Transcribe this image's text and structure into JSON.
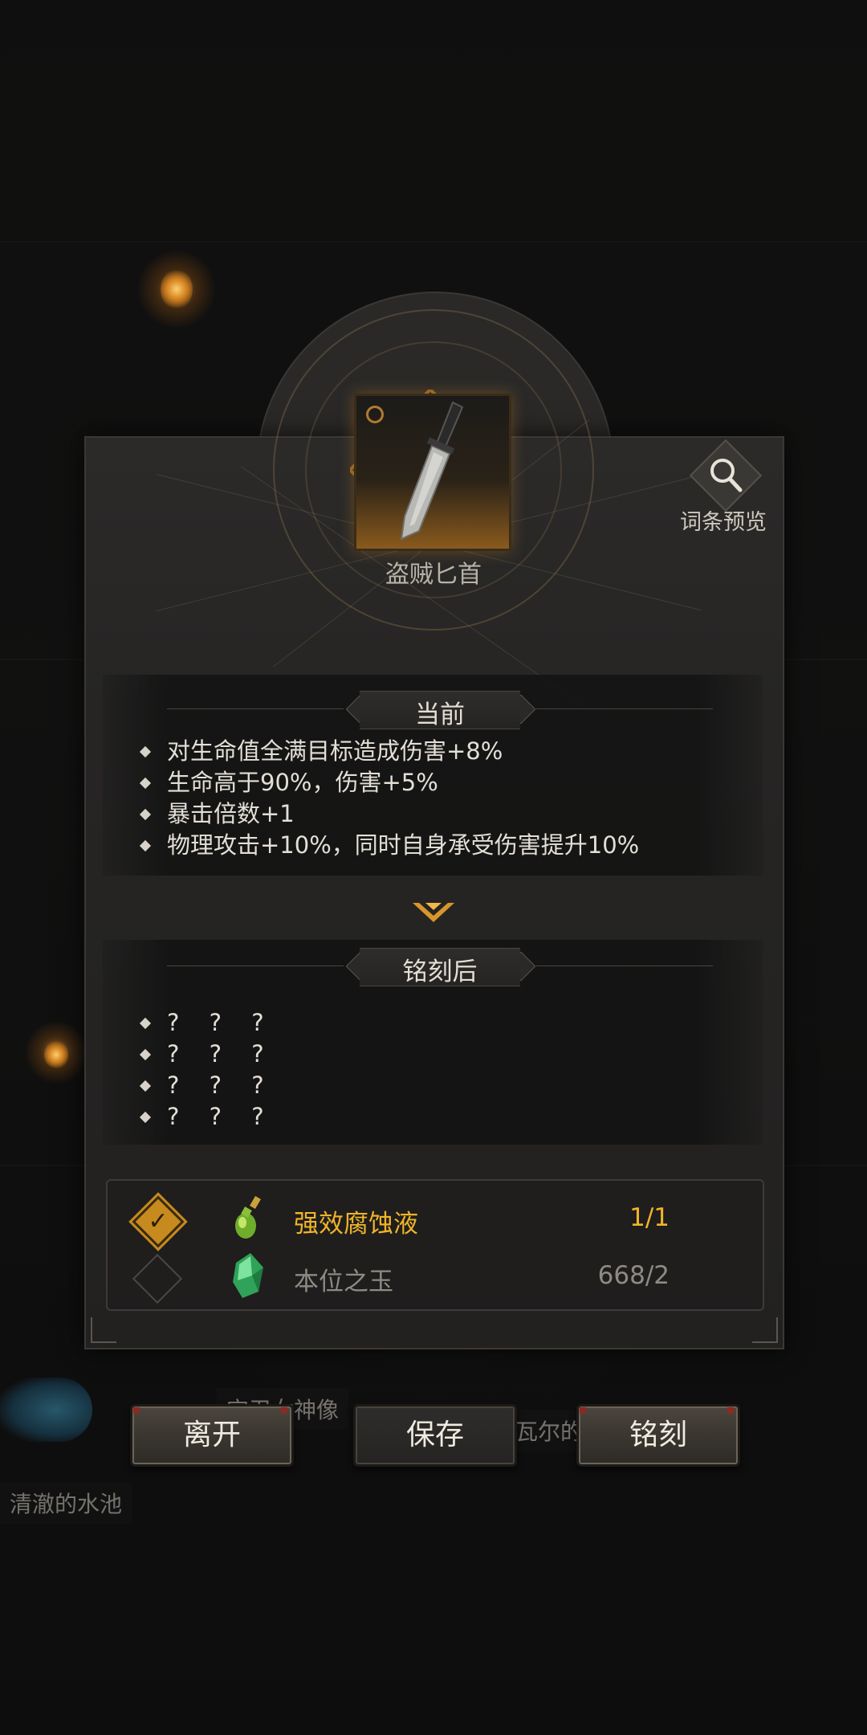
{
  "item": {
    "name": "盗贼匕首",
    "preview_label": "词条预览"
  },
  "current": {
    "title": "当前",
    "affixes": [
      "对生命值全满目标造成伤害+8%",
      "生命高于90%，伤害+5%",
      "暴击倍数+1",
      "物理攻击+10%，同时自身承受伤害提升10%"
    ]
  },
  "after": {
    "title": "铭刻后",
    "affixes": [
      "? ? ?",
      "? ? ?",
      "? ? ?",
      "? ? ?"
    ]
  },
  "materials": [
    {
      "name": "强效腐蚀液",
      "count": "1/1",
      "selected": true,
      "color": "#f0b429",
      "icon": "potion-icon"
    },
    {
      "name": "本位之玉",
      "count": "668/2",
      "selected": false,
      "color": "#8e8a84",
      "icon": "jade-icon"
    }
  ],
  "buttons": {
    "leave": "离开",
    "save": "保存",
    "engrave": "铭刻"
  },
  "background": {
    "statue_label": "守卫女神像",
    "pool_label": "清澈的水池",
    "partial_label": "瓦尔的"
  }
}
